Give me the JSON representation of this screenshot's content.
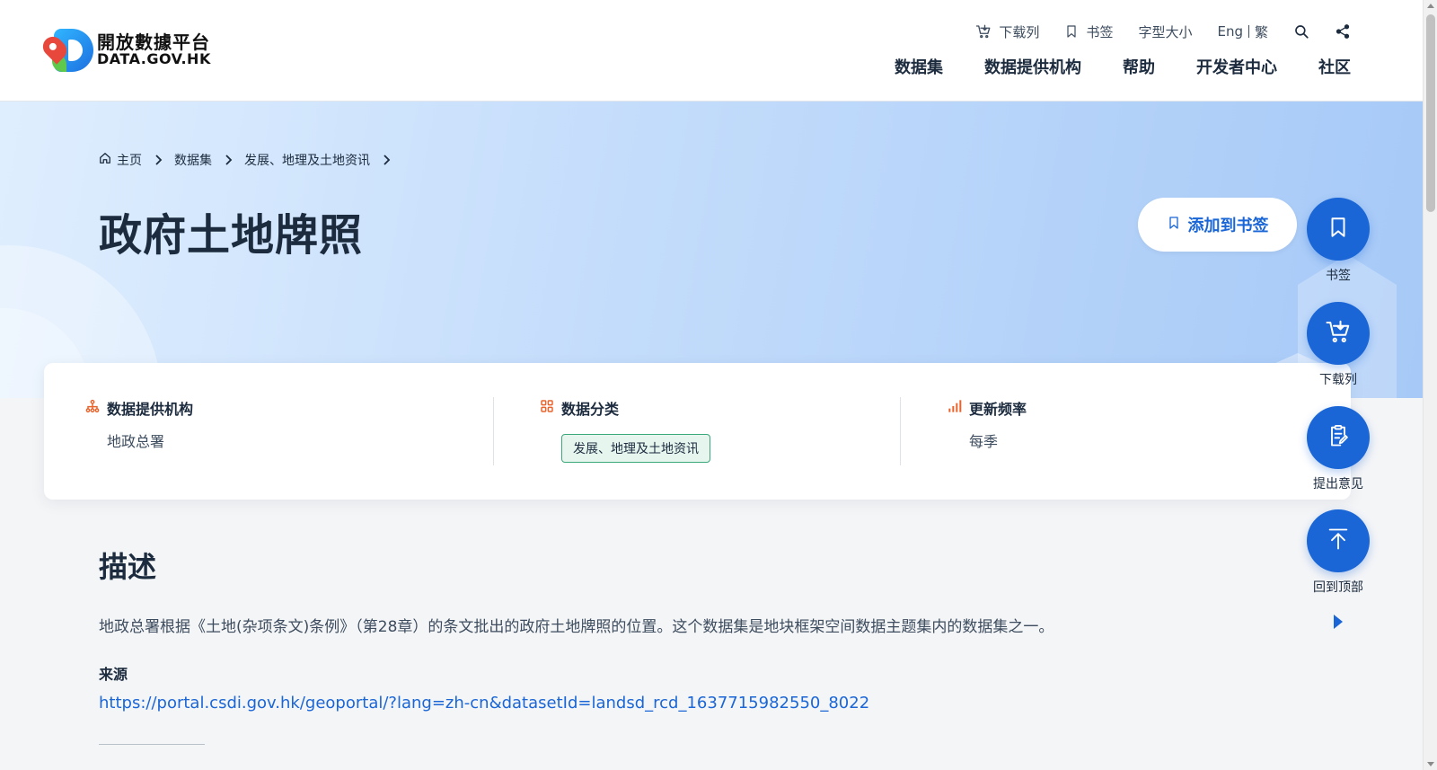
{
  "site": {
    "logo_cn": "開放數據平台",
    "logo_en": "DATA.GOV.HK"
  },
  "utility_nav": {
    "download_list": "下载列",
    "bookmarks": "书签",
    "font_size": "字型大小",
    "lang_eng": "Eng",
    "lang_trad": "繁"
  },
  "main_nav": [
    "数据集",
    "数据提供机构",
    "帮助",
    "开发者中心",
    "社区"
  ],
  "breadcrumb": {
    "home": "主页",
    "items": [
      "数据集",
      "发展、地理及土地资讯"
    ]
  },
  "page": {
    "title": "政府土地牌照",
    "add_bookmark": "添加到书签"
  },
  "info": {
    "provider_label": "数据提供机构",
    "provider_value": "地政总署",
    "category_label": "数据分类",
    "category_value": "发展、地理及土地资讯",
    "frequency_label": "更新频率",
    "frequency_value": "每季"
  },
  "description": {
    "title": "描述",
    "text": "地政总署根据《土地(杂项条文)条例》（第28章）的条文批出的政府土地牌照的位置。这个数据集是地块框架空间数据主题集内的数据集之一。",
    "source_label": "来源",
    "source_url": "https://portal.csdi.gov.hk/geoportal/?lang=zh-cn&datasetId=landsd_rcd_1637715982550_8022"
  },
  "side_actions": {
    "bookmark": "书签",
    "download_list": "下载列",
    "feedback": "提出意见",
    "back_to_top": "回到顶部"
  },
  "colors": {
    "primary": "#1a66d6",
    "accent_orange": "#e8642c",
    "tag_green": "#3aa87a",
    "text_dark": "#1c2b3e"
  }
}
